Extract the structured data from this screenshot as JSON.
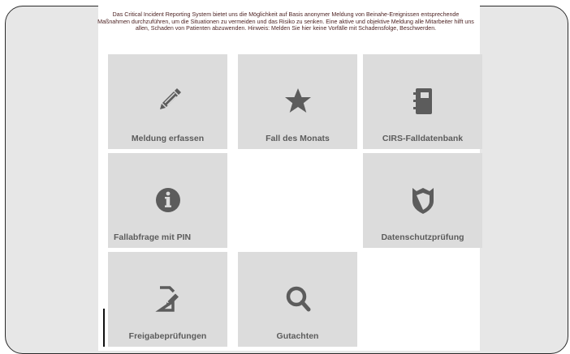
{
  "intro_text": "Das Critical Incident Reporting System bietet uns die Möglichkeit auf Basis anonymer Meldung von Beinahe-Ereignissen entsprechende Maßnahmen durchzuführen, um die Situationen zu vermeiden und das Risiko zu senken. Eine aktive und objektive Meldung alle Mitarbeiter hilft uns allen, Schaden von Patienten abzuwenden. Hinweis: Melden Sie hier keine Vorfälle mit Schadensfolge, Beschwerden.",
  "colors": {
    "tile_bg": "#dcdcdc",
    "icon": "#5c5c5c",
    "label": "#5c5c5c",
    "intro_text": "#4a1f1f",
    "outside_bg": "#e7e7e7"
  },
  "tiles": [
    {
      "label": "Meldung erfassen",
      "icon": "pencil-icon"
    },
    {
      "label": "Fall des Monats",
      "icon": "star-icon"
    },
    {
      "label": "CIRS-Falldatenbank",
      "icon": "notebook-icon"
    },
    {
      "label": "Fallabfrage mit PIN",
      "icon": "info-icon"
    },
    {
      "label": "Datenschutzprüfung",
      "icon": "shield-icon"
    },
    {
      "label": "Freigabeprüfungen",
      "icon": "edit-document-icon"
    },
    {
      "label": "Gutachten",
      "icon": "search-icon"
    }
  ]
}
